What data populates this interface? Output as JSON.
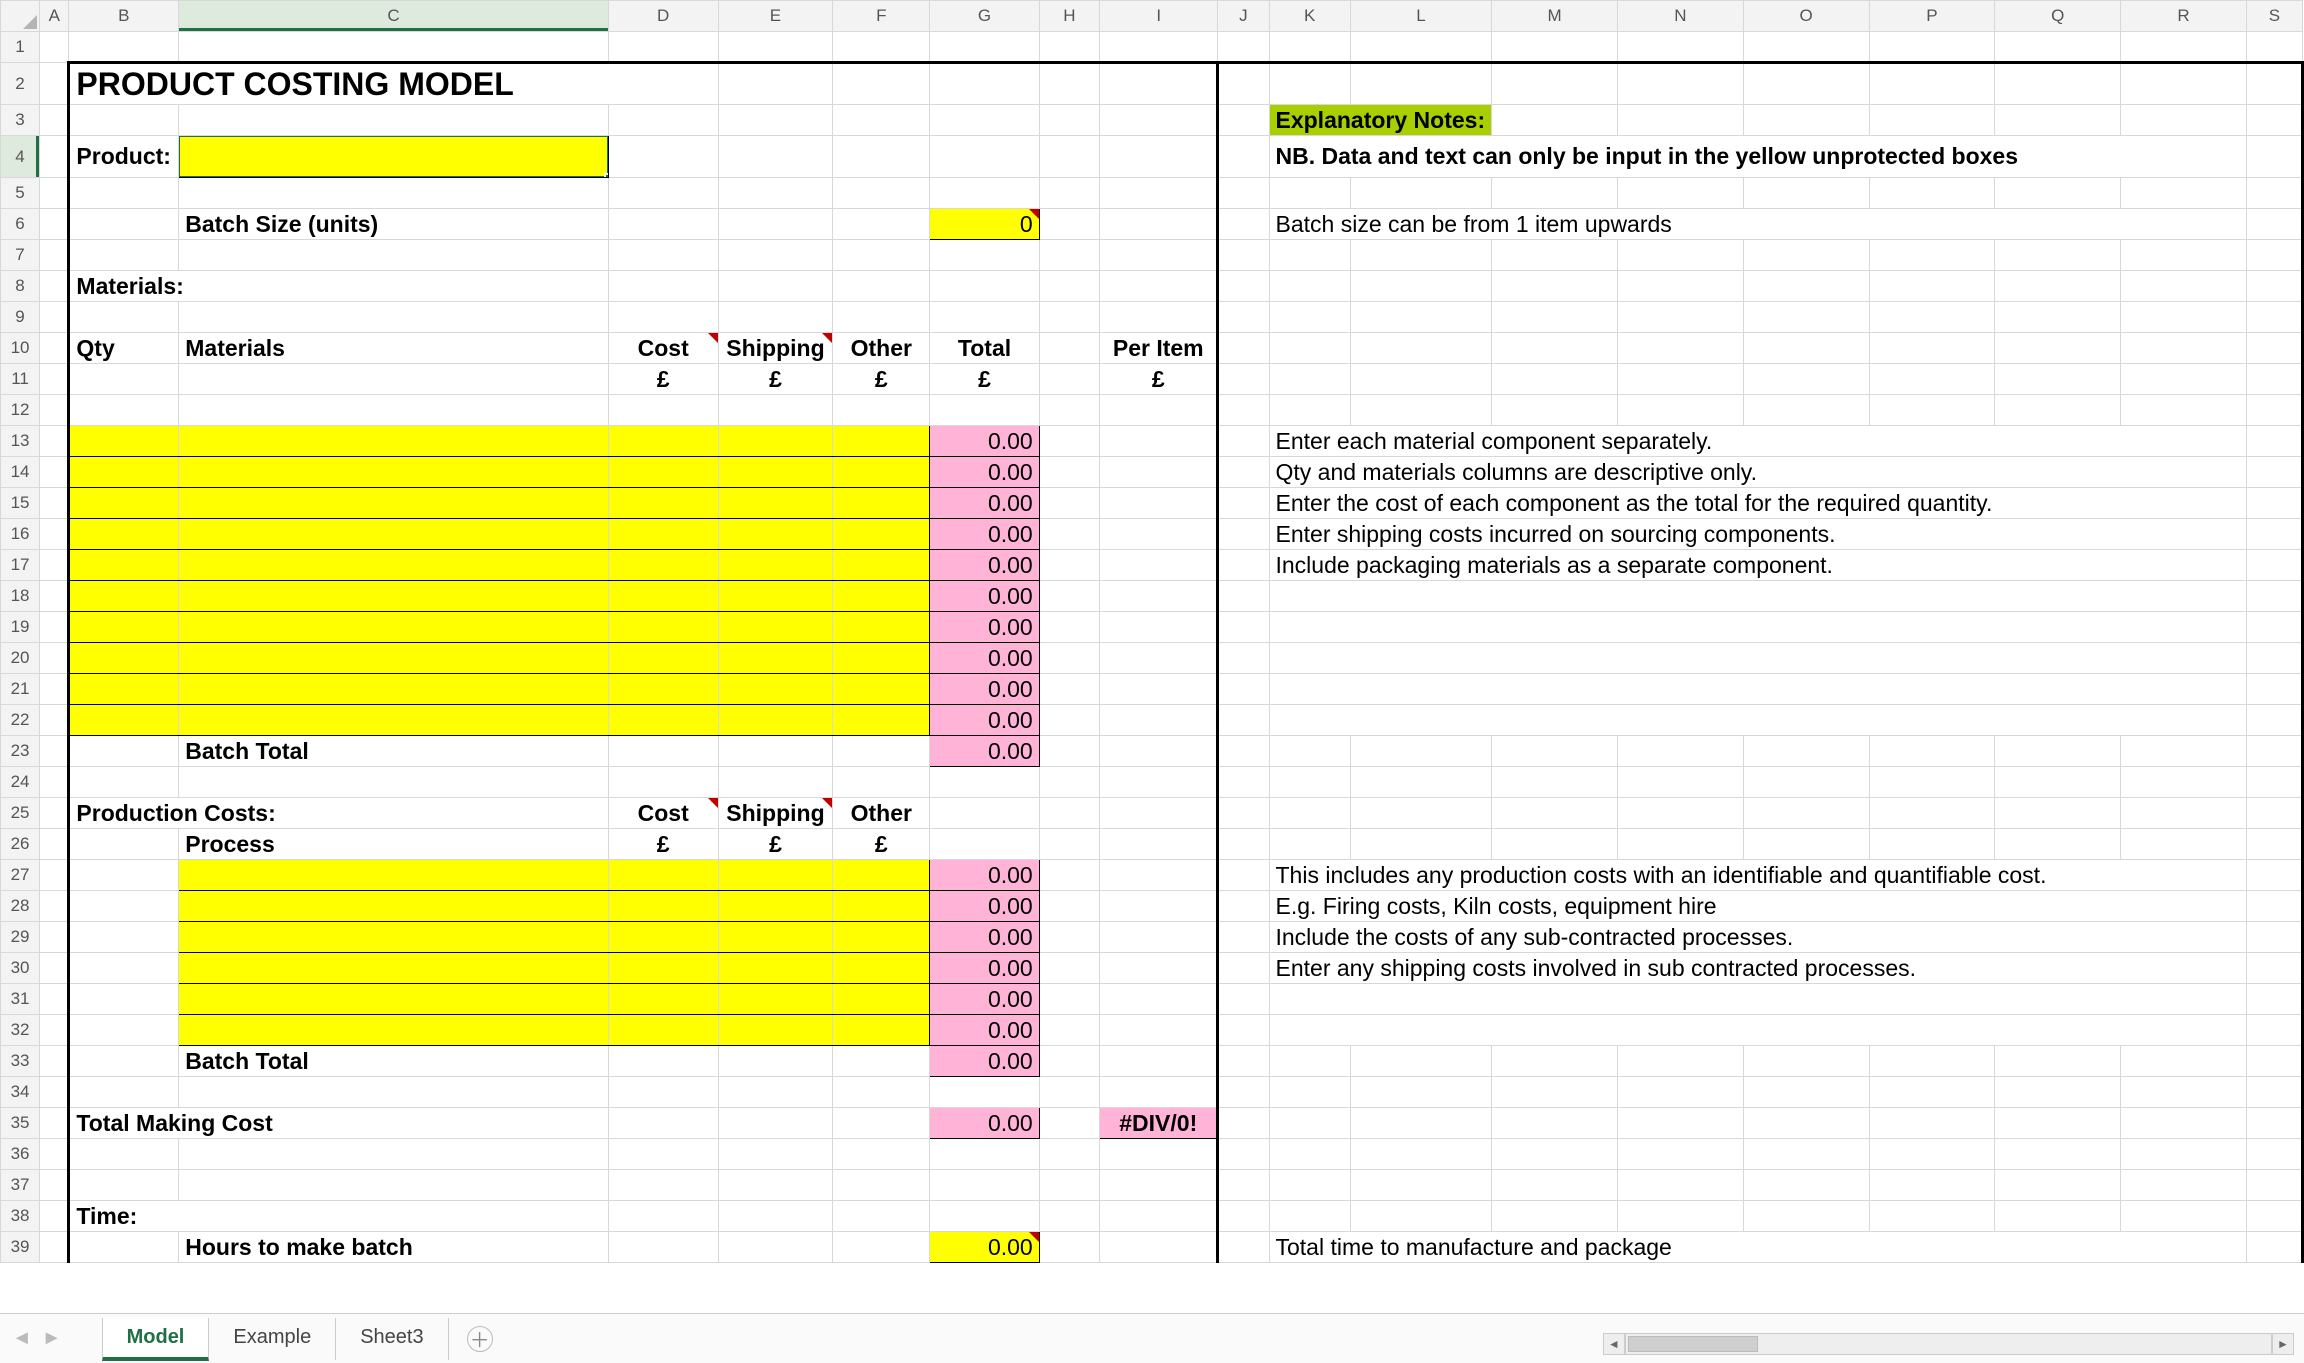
{
  "columns": [
    "A",
    "B",
    "C",
    "D",
    "E",
    "F",
    "G",
    "H",
    "I",
    "J",
    "K",
    "L",
    "M",
    "N",
    "O",
    "P",
    "Q",
    "R",
    "S"
  ],
  "activeCell": "C4",
  "title": "PRODUCT COSTING MODEL",
  "labels": {
    "product": "Product:",
    "batchSize": "Batch Size (units)",
    "materialsHdr": "Materials:",
    "qty": "Qty",
    "materials": "Materials",
    "cost": "Cost",
    "shipping": "Shipping",
    "other": "Other",
    "total": "Total",
    "perItem": "Per Item",
    "gbp": "£",
    "batchTotal": "Batch Total",
    "prodCosts": "Production Costs:",
    "process": "Process",
    "totalMaking": "Total Making Cost",
    "timeHdr": "Time:",
    "hoursToMake": "Hours to make batch"
  },
  "values": {
    "batchSize": "0",
    "totalRows": [
      "0.00",
      "0.00",
      "0.00",
      "0.00",
      "0.00",
      "0.00",
      "0.00",
      "0.00",
      "0.00",
      "0.00"
    ],
    "batchTotalMaterials": "0.00",
    "prodTotals": [
      "0.00",
      "0.00",
      "0.00",
      "0.00",
      "0.00",
      "0.00"
    ],
    "batchTotalProduction": "0.00",
    "totalMakingCost": "0.00",
    "perItemDiv0": "#DIV/0!",
    "hoursToMake": "0.00"
  },
  "notes": {
    "header": "Explanatory Notes:",
    "nb": "NB. Data and text can only be input in the yellow unprotected boxes",
    "batchNote": "Batch size can be from 1 item upwards",
    "mat1": "Enter each material component separately.",
    "mat2": "Qty and materials columns are descriptive only.",
    "mat3": "Enter the cost of each component as the total for the required quantity.",
    "mat4": "Enter shipping costs incurred on sourcing components.",
    "mat5": "Include packaging materials as a separate component.",
    "prod1": "This includes any production costs with an identifiable and quantifiable cost.",
    "prod2": "E.g.  Firing costs, Kiln costs, equipment hire",
    "prod3": "Include the costs of any sub-contracted processes.",
    "prod4": "Enter any shipping costs involved in sub contracted processes.",
    "timeNote": "Total time to manufacture and package"
  },
  "tabs": [
    "Model",
    "Example",
    "Sheet3"
  ],
  "activeTab": "Model"
}
